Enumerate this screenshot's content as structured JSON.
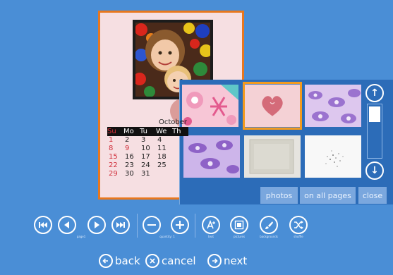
{
  "calendar": {
    "month": "October",
    "weekdays": [
      "Su",
      "Mo",
      "Tu",
      "We",
      "Th"
    ],
    "rows": [
      [
        "1",
        "2",
        "3",
        "4",
        ""
      ],
      [
        "8",
        "9",
        "10",
        "11",
        ""
      ],
      [
        "15",
        "16",
        "17",
        "18",
        ""
      ],
      [
        "22",
        "23",
        "24",
        "25",
        ""
      ],
      [
        "29",
        "30",
        "31",
        "",
        ""
      ]
    ]
  },
  "picker": {
    "buttons": {
      "photos": "photos",
      "all_pages": "on all pages",
      "close": "close"
    },
    "scroll_up_icon": "arrow-up-icon",
    "scroll_down_icon": "arrow-down-icon"
  },
  "toolbar": {
    "page_label": "page1",
    "quantity_label": "quantity: 1",
    "text_label": "text",
    "pictures_label": "pictures",
    "backgrounds_label": "backgrounds",
    "shuffle_label": "shuffle"
  },
  "nav": {
    "back": "back",
    "cancel": "cancel",
    "next": "next"
  },
  "colors": {
    "background": "#4a8ed6",
    "accent": "#e8771e",
    "selection": "#f39a1e"
  }
}
